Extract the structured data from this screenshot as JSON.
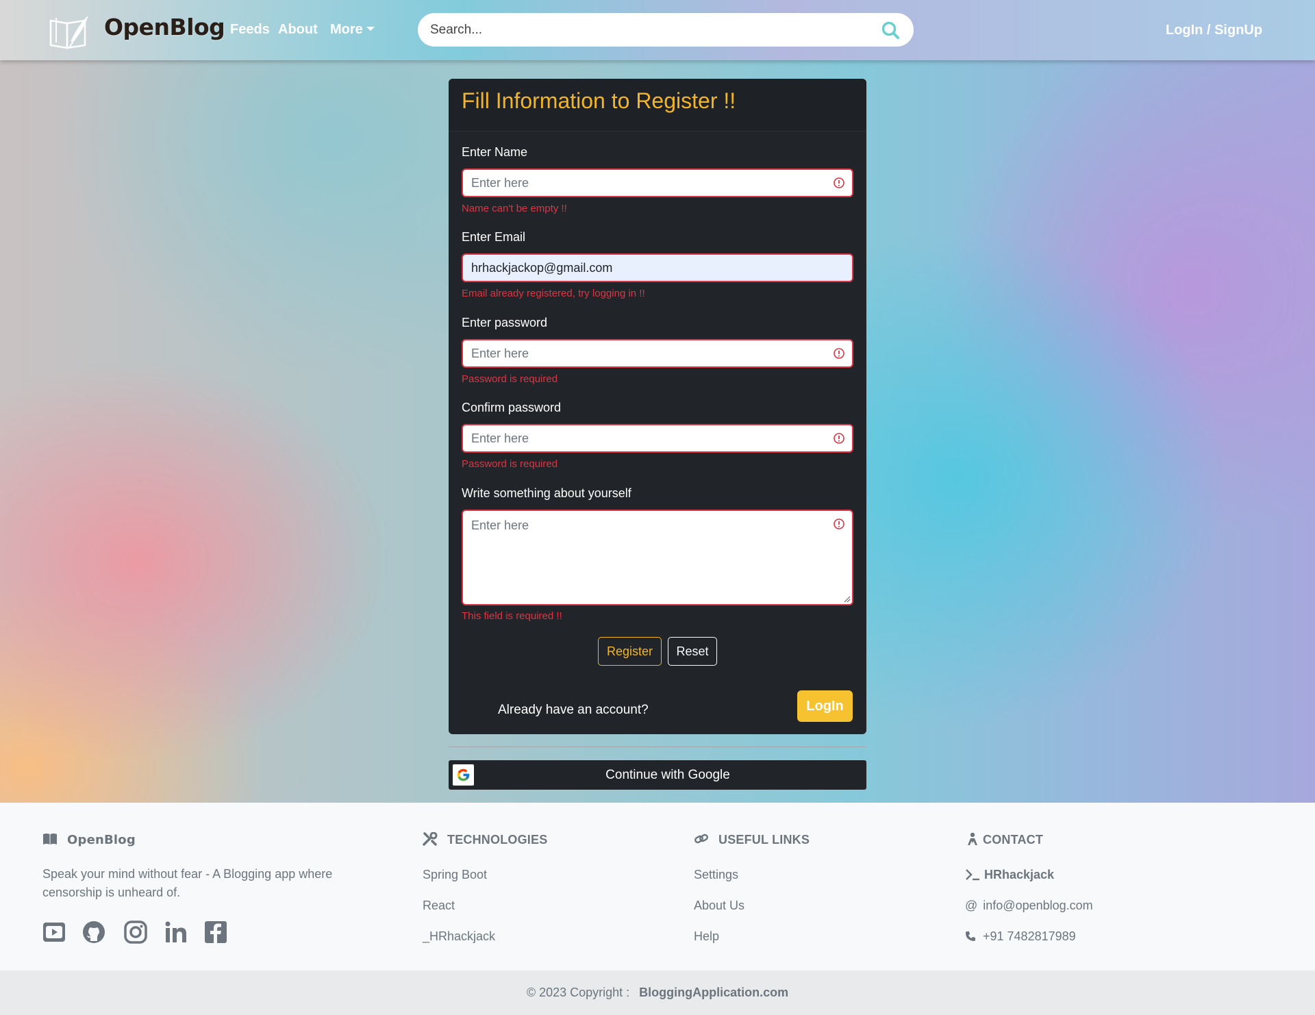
{
  "navbar": {
    "brand": "OpenBlog",
    "links": {
      "feeds": "Feeds",
      "about": "About",
      "more": "More"
    },
    "search_placeholder": "Search...",
    "login": "LogIn / SignUp"
  },
  "form": {
    "title": "Fill Information to Register !!",
    "fields": {
      "name": {
        "label": "Enter Name",
        "placeholder": "Enter here",
        "value": "",
        "error": "Name can't be empty !!"
      },
      "email": {
        "label": "Enter Email",
        "placeholder": "Enter here",
        "value": "hrhackjackop@gmail.com",
        "error": "Email already registered, try logging in !!"
      },
      "password": {
        "label": "Enter password",
        "placeholder": "Enter here",
        "value": "",
        "error": "Password is required"
      },
      "confirm": {
        "label": "Confirm password",
        "placeholder": "Enter here",
        "value": "",
        "error": "Password is required"
      },
      "about": {
        "label": "Write something about yourself",
        "placeholder": "Enter here",
        "value": "",
        "error": "This field is required !!"
      }
    },
    "register_button": "Register",
    "reset_button": "Reset",
    "already_text": "Already have an account?",
    "login_button": "LogIn",
    "google_button": "Continue with Google"
  },
  "footer": {
    "brand": "OpenBlog",
    "tagline": "Speak your mind without fear - A Blogging app where censorship is unheard of.",
    "technologies": {
      "heading": "TECHNOLOGIES",
      "items": [
        "Spring Boot",
        "React",
        "_HRhackjack"
      ]
    },
    "useful_links": {
      "heading": "USEFUL LINKS",
      "items": [
        "Settings",
        "About Us",
        "Help"
      ]
    },
    "contact": {
      "heading": "CONTACT",
      "handle": "HRhackjack",
      "email": "info@openblog.com",
      "phone": "+91 7482817989"
    },
    "copyright_prefix": "© 2023 Copyright :",
    "copyright_site": "BloggingApplication.com"
  },
  "icons": {
    "brand": "book-feather-icon",
    "search": "search-icon",
    "warning": "exclamation-circle-icon",
    "google": "google-g-icon",
    "socials": [
      "youtube-icon",
      "github-icon",
      "instagram-icon",
      "linkedin-icon",
      "facebook-icon"
    ]
  },
  "colors": {
    "accent_yellow": "#f2b529",
    "error_red": "#dc3545",
    "card_dark": "#212529",
    "search_teal": "#6ccfcf"
  }
}
